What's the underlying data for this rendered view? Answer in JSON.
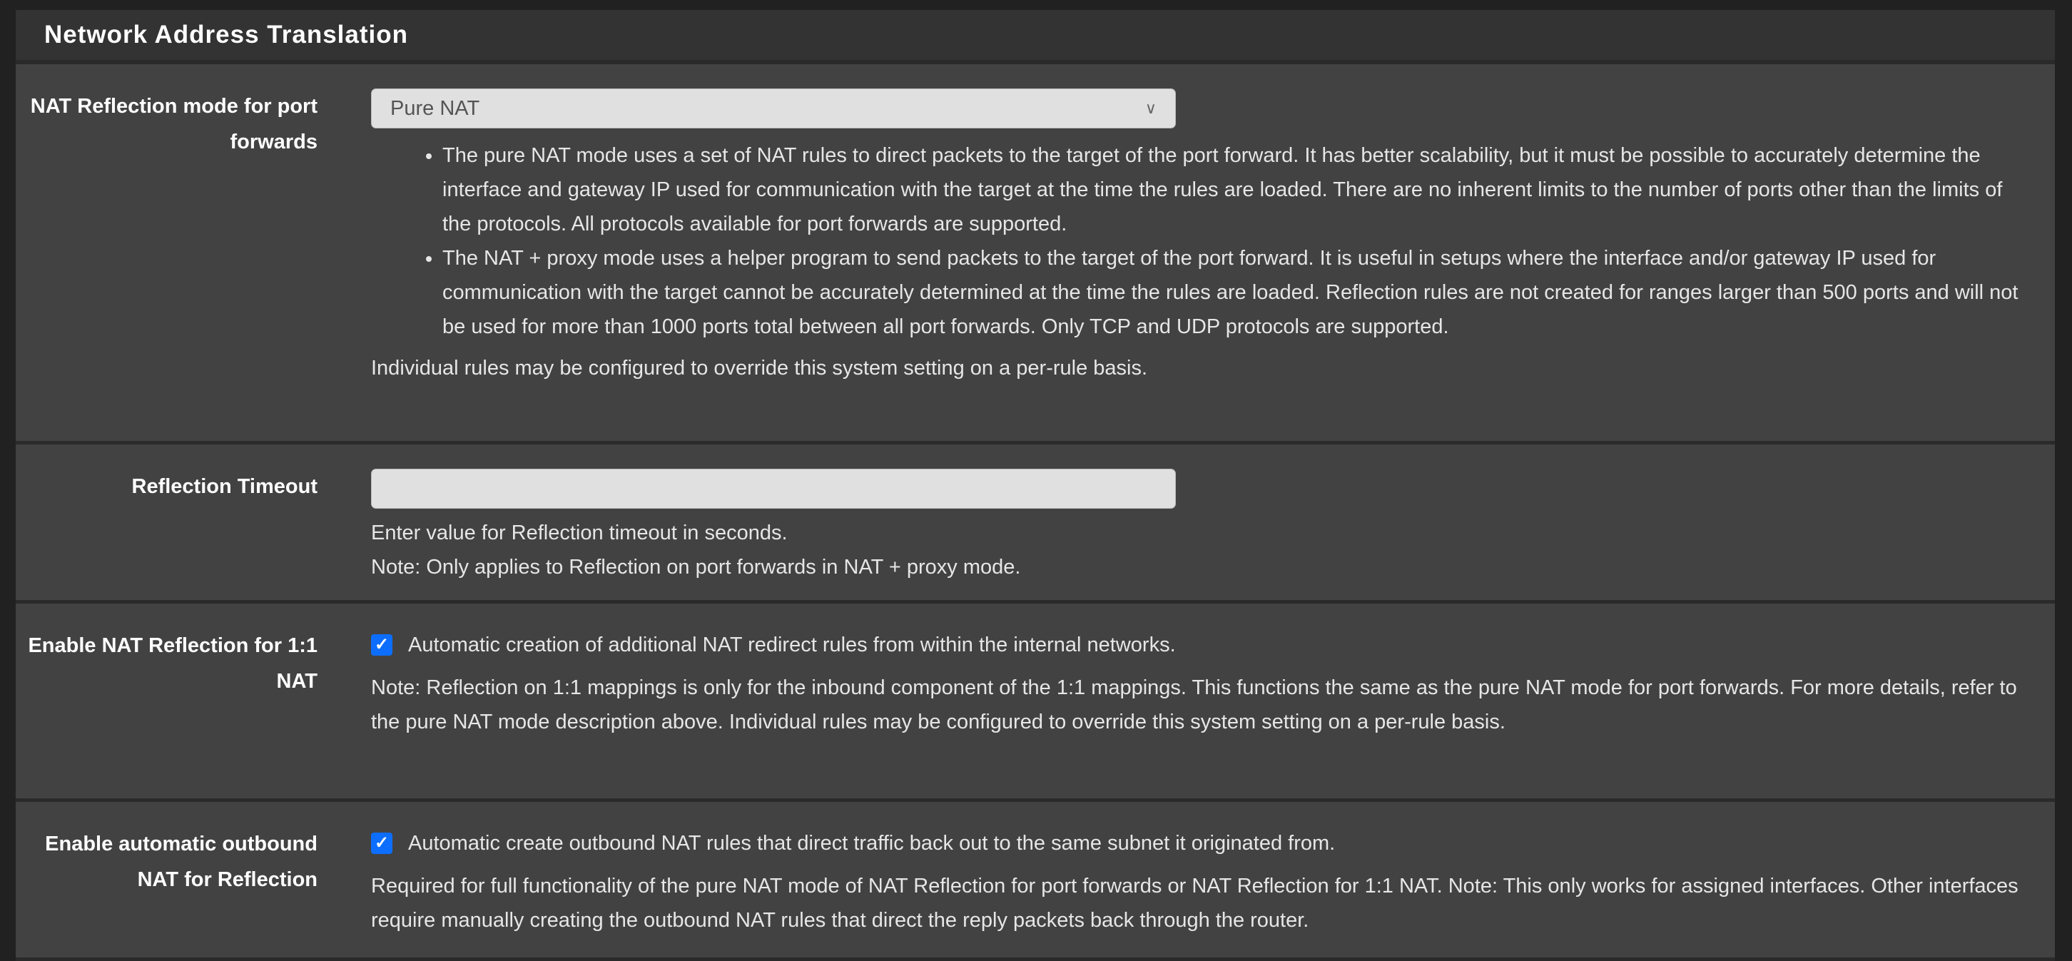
{
  "section_title": "Network Address Translation",
  "rows": [
    {
      "label": "NAT Reflection mode for port forwards",
      "select_value": "Pure NAT",
      "bullets": [
        "The pure NAT mode uses a set of NAT rules to direct packets to the target of the port forward. It has better scalability, but it must be possible to accurately determine the interface and gateway IP used for communication with the target at the time the rules are loaded. There are no inherent limits to the number of ports other than the limits of the protocols. All protocols available for port forwards are supported.",
        "The NAT + proxy mode uses a helper program to send packets to the target of the port forward. It is useful in setups where the interface and/or gateway IP used for communication with the target cannot be accurately determined at the time the rules are loaded. Reflection rules are not created for ranges larger than 500 ports and will not be used for more than 1000 ports total between all port forwards. Only TCP and UDP protocols are supported."
      ],
      "help": "Individual rules may be configured to override this system setting on a per-rule basis."
    },
    {
      "label": "Reflection Timeout",
      "input_value": "",
      "help1": "Enter value for Reflection timeout in seconds.",
      "help2": "Note: Only applies to Reflection on port forwards in NAT + proxy mode."
    },
    {
      "label": "Enable NAT Reflection for 1:1 NAT",
      "checked": true,
      "checkbox_label": "Automatic creation of additional NAT redirect rules from within the internal networks.",
      "help": "Note: Reflection on 1:1 mappings is only for the inbound component of the 1:1 mappings. This functions the same as the pure NAT mode for port forwards. For more details, refer to the pure NAT mode description above. Individual rules may be configured to override this system setting on a per-rule basis."
    },
    {
      "label": "Enable automatic outbound NAT for Reflection",
      "checked": true,
      "checkbox_label": "Automatic create outbound NAT rules that direct traffic back out to the same subnet it originated from.",
      "help": "Required for full functionality of the pure NAT mode of NAT Reflection for port forwards or NAT Reflection for 1:1 NAT. Note: This only works for assigned interfaces. Other interfaces require manually creating the outbound NAT rules that direct the reply packets back through the router."
    }
  ],
  "colors": {
    "checkbox": "#0d6efd",
    "panel": "#424242",
    "header": "#333333"
  }
}
